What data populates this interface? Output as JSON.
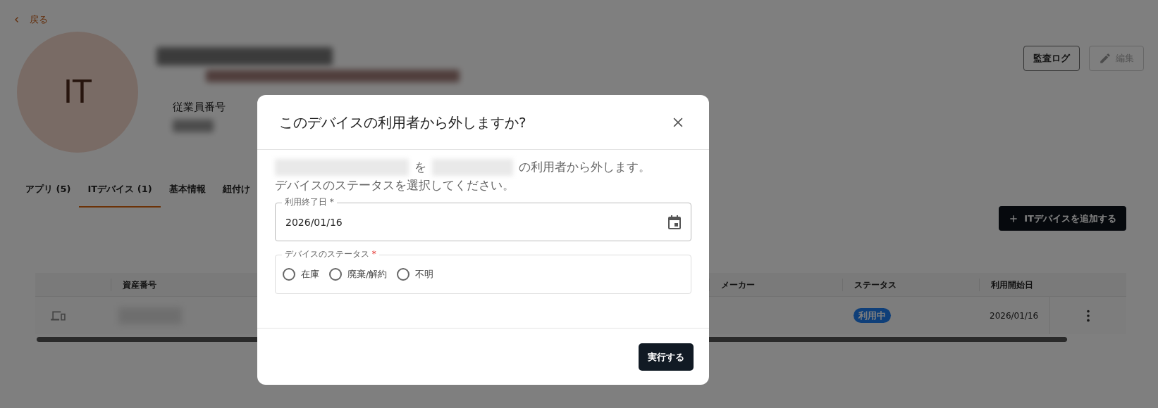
{
  "back_link": {
    "label": "戻る"
  },
  "profile": {
    "avatar_initials": "IT",
    "fields": [
      {
        "label": "従業員番号"
      }
    ]
  },
  "header_buttons": [
    {
      "label": "監査ログ",
      "kind": "plain",
      "disabled": false
    },
    {
      "label": "編集",
      "kind": "edit",
      "disabled": true
    }
  ],
  "tabs": [
    {
      "label": "アプリ (5)",
      "selected": false
    },
    {
      "label": "ITデバイス (1)",
      "selected": true
    },
    {
      "label": "基本情報",
      "selected": false
    },
    {
      "label": "紐付け",
      "selected": false
    }
  ],
  "add_button": {
    "label": "ITデバイスを追加する"
  },
  "table": {
    "columns": [
      {
        "kind": "icon"
      },
      {
        "kind": "text",
        "label": "資産番号"
      },
      {
        "kind": "hidden"
      },
      {
        "kind": "text",
        "label": "メーカー"
      },
      {
        "kind": "text",
        "label": "ステータス"
      },
      {
        "kind": "text",
        "label": "利用開始日"
      }
    ],
    "rows": [
      {
        "status": "利用中",
        "start_date": "2026/01/16"
      }
    ]
  },
  "dialog": {
    "title": "このデバイスの利用者から外しますか?",
    "message": [
      {
        "kind": "redacted"
      },
      {
        "kind": "text",
        "text": "を"
      },
      {
        "kind": "redacted"
      },
      {
        "kind": "text",
        "text": "の利用者から外します。"
      }
    ],
    "instruction": "デバイスのステータスを選択してください。",
    "date_field": {
      "label": "利用終了日 *",
      "value": "2026/01/16"
    },
    "status_field": {
      "label": "デバイスのステータス",
      "required_mark": "*",
      "options": [
        {
          "label": "在庫",
          "selected": false
        },
        {
          "label": "廃棄/解約",
          "selected": false
        },
        {
          "label": "不明",
          "selected": false
        }
      ]
    },
    "submit": {
      "label": "実行する"
    }
  }
}
